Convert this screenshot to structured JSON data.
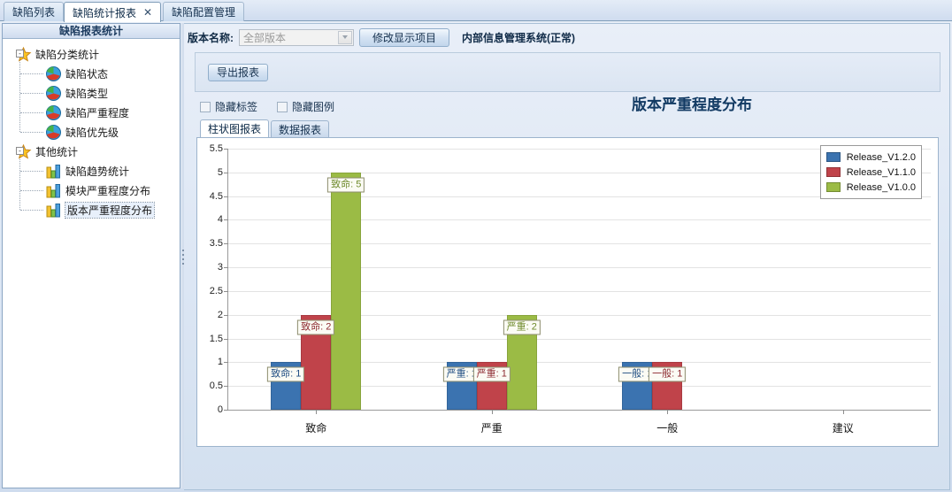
{
  "tabs": [
    {
      "label": "缺陷列表",
      "active": false,
      "closable": false
    },
    {
      "label": "缺陷统计报表",
      "active": true,
      "closable": true,
      "close_icon": "close-icon"
    },
    {
      "label": "缺陷配置管理",
      "active": false,
      "closable": false
    }
  ],
  "sidebar": {
    "header": "缺陷报表统计",
    "nodes": [
      {
        "label": "缺陷分类统计",
        "level": 0,
        "icon": "star-icon",
        "expander": "-",
        "selected": false
      },
      {
        "label": "缺陷状态",
        "level": 1,
        "icon": "pie-chart-icon",
        "selected": false
      },
      {
        "label": "缺陷类型",
        "level": 1,
        "icon": "pie-chart-icon",
        "selected": false
      },
      {
        "label": "缺陷严重程度",
        "level": 1,
        "icon": "pie-chart-icon",
        "selected": false
      },
      {
        "label": "缺陷优先级",
        "level": 1,
        "icon": "pie-chart-icon",
        "selected": false
      },
      {
        "label": "其他统计",
        "level": 0,
        "icon": "star-icon",
        "expander": "-",
        "selected": false
      },
      {
        "label": "缺陷趋势统计",
        "level": 1,
        "icon": "bar-chart-icon",
        "selected": false
      },
      {
        "label": "模块严重程度分布",
        "level": 1,
        "icon": "bar-chart-icon",
        "selected": false
      },
      {
        "label": "版本严重程度分布",
        "level": 1,
        "icon": "bar-chart-icon",
        "selected": true
      }
    ]
  },
  "toolbar": {
    "version_label": "版本名称:",
    "version_value": "全部版本",
    "modify_button": "修改显示项目",
    "system_name": "内部信息管理系统(正常)"
  },
  "export": {
    "button": "导出报表"
  },
  "options": {
    "hide_labels": {
      "label": "隐藏标签",
      "checked": false
    },
    "hide_legend": {
      "label": "隐藏图例",
      "checked": false
    }
  },
  "report_tabs": [
    {
      "label": "柱状图报表",
      "active": true
    },
    {
      "label": "数据报表",
      "active": false
    }
  ],
  "chart_data": {
    "type": "bar",
    "title": "版本严重程度分布",
    "xlabel": "",
    "ylabel": "",
    "ylim": [
      0,
      5.5
    ],
    "yticks": [
      0,
      0.5,
      1,
      1.5,
      2,
      2.5,
      3,
      3.5,
      4,
      4.5,
      5,
      5.5
    ],
    "ytick_labels": [
      "0",
      "0.5",
      "1",
      "1.5",
      "2",
      "2.5",
      "3",
      "3.5",
      "4",
      "4.5",
      "5",
      "5.5"
    ],
    "grid": true,
    "legend_position": "top-right",
    "categories": [
      "致命",
      "严重",
      "一般",
      "建议"
    ],
    "series": [
      {
        "name": "Release_V1.2.0",
        "color": "#3b73b0",
        "values": [
          1,
          1,
          1,
          0
        ]
      },
      {
        "name": "Release_V1.1.0",
        "color": "#c0434a",
        "values": [
          2,
          1,
          1,
          0
        ]
      },
      {
        "name": "Release_V1.0.0",
        "color": "#9bbb45",
        "values": [
          5,
          2,
          0,
          0
        ]
      }
    ],
    "point_labels": [
      {
        "series": 0,
        "category": 0,
        "text": "致命: 1",
        "color": "#1f4d82"
      },
      {
        "series": 1,
        "category": 0,
        "text": "致命: 2",
        "color": "#8d2a30"
      },
      {
        "series": 2,
        "category": 0,
        "text": "致命: 5",
        "color": "#6e8a2b"
      },
      {
        "series": 0,
        "category": 1,
        "text": "严重: 1",
        "color": "#1f4d82"
      },
      {
        "series": 1,
        "category": 1,
        "text": "严重: 1",
        "color": "#8d2a30"
      },
      {
        "series": 2,
        "category": 1,
        "text": "严重: 2",
        "color": "#6e8a2b"
      },
      {
        "series": 0,
        "category": 2,
        "text": "一般: 1",
        "color": "#1f4d82"
      },
      {
        "series": 1,
        "category": 2,
        "text": "一般: 1",
        "color": "#8d2a30"
      }
    ]
  }
}
